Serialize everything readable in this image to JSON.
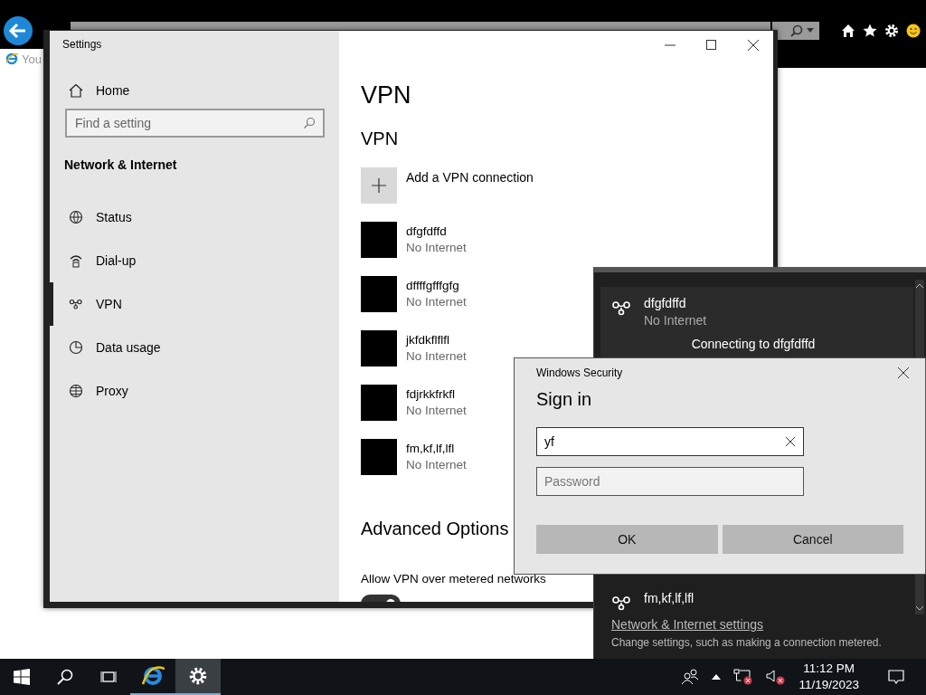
{
  "browser": {
    "tab": {
      "title": "You"
    }
  },
  "settings_window": {
    "title": "Settings",
    "sidebar": {
      "home": "Home",
      "search": {
        "placeholder": "Find a setting"
      },
      "section": "Network & Internet",
      "items": [
        {
          "kind": "status",
          "label": "Status",
          "selected": false
        },
        {
          "kind": "dialup",
          "label": "Dial-up",
          "selected": false
        },
        {
          "kind": "vpn",
          "label": "VPN",
          "selected": true
        },
        {
          "kind": "data",
          "label": "Data usage",
          "selected": false
        },
        {
          "kind": "proxy",
          "label": "Proxy",
          "selected": false
        }
      ]
    },
    "page": {
      "title": "VPN",
      "section": "VPN",
      "add_label": "Add a VPN connection",
      "connections": [
        {
          "name": "dfgfdffd",
          "status": "No Internet"
        },
        {
          "name": "dffffgfffgfg",
          "status": "No Internet"
        },
        {
          "name": "jkfdkflflfl",
          "status": "No Internet"
        },
        {
          "name": "fdjrkkfrkfl",
          "status": "No Internet"
        },
        {
          "name": "fm,kf,lf,lfl",
          "status": "No Internet"
        }
      ],
      "advanced_title": "Advanced Options",
      "options": [
        {
          "label": "Allow VPN over metered networks",
          "on": true
        }
      ]
    }
  },
  "network_flyout": {
    "items": [
      {
        "name": "dfgfdffd",
        "status": "No Internet",
        "message": "Connecting to dfgfdffd",
        "expanded": true
      },
      {
        "name": "fm,kf,lf,lfl",
        "expanded": false
      }
    ],
    "settings_link": "Network & Internet settings",
    "settings_hint": "Change settings, such as making a connection metered."
  },
  "sign_in_dialog": {
    "title": "Windows Security",
    "heading": "Sign in",
    "username": {
      "value": "yf"
    },
    "password": {
      "placeholder": "Password"
    },
    "buttons": [
      "OK",
      "Cancel"
    ]
  },
  "taskbar": {
    "time": "11:12 PM",
    "date": "11/19/2023"
  }
}
